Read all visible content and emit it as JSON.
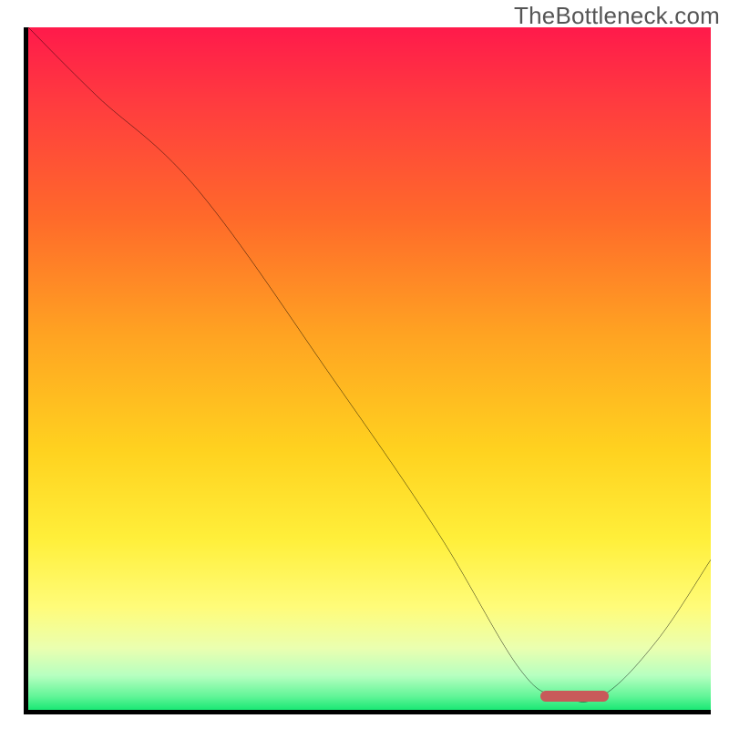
{
  "watermark": "TheBottleneck.com",
  "chart_data": {
    "type": "line",
    "title": "",
    "xlabel": "",
    "ylabel": "",
    "xlim": [
      0,
      100
    ],
    "ylim": [
      0,
      100
    ],
    "grid": false,
    "legend": false,
    "series": [
      {
        "name": "curve",
        "x": [
          0,
          10,
          25,
          45,
          60,
          72,
          78,
          84,
          92,
          100
        ],
        "y": [
          100,
          90,
          76,
          48,
          26,
          6,
          2,
          2,
          10,
          22
        ]
      }
    ],
    "annotations": [
      {
        "name": "optimal-marker",
        "type": "bar-segment",
        "x_start": 75,
        "x_end": 85,
        "y": 2,
        "color": "#c85a5a"
      }
    ],
    "background_gradient": {
      "direction": "vertical",
      "stops": [
        {
          "pos": 0.0,
          "color": "#ff1a4b"
        },
        {
          "pos": 0.28,
          "color": "#ff6a2a"
        },
        {
          "pos": 0.62,
          "color": "#ffd21f"
        },
        {
          "pos": 0.85,
          "color": "#fffc7a"
        },
        {
          "pos": 0.95,
          "color": "#b6ffc0"
        },
        {
          "pos": 1.0,
          "color": "#1ae874"
        }
      ]
    }
  }
}
